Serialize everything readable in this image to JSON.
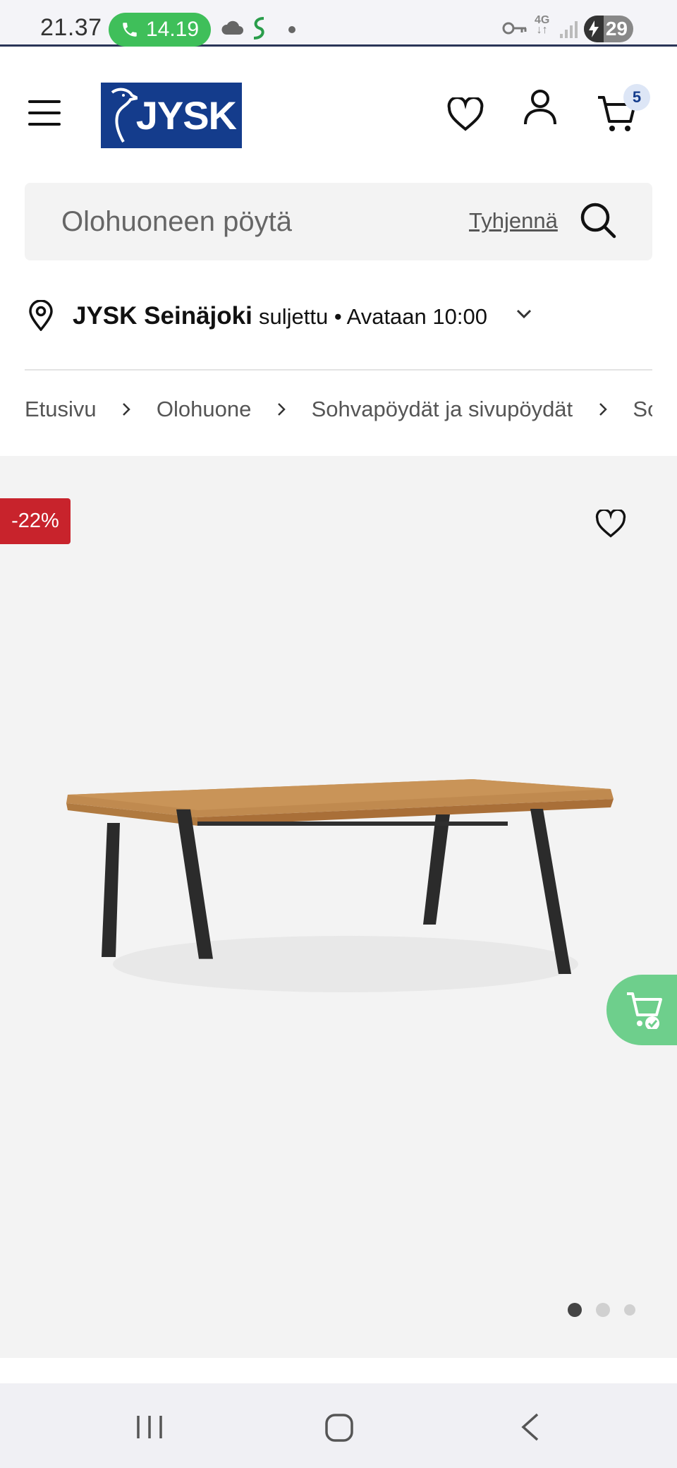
{
  "status_bar": {
    "time": "21.37",
    "call_timer": "14.19",
    "network": "4G",
    "battery": "29"
  },
  "header": {
    "logo_text": "JYSK",
    "cart_count": "5"
  },
  "search": {
    "value": "Olohuoneen pöytä",
    "clear_label": "Tyhjennä"
  },
  "store": {
    "name": "JYSK Seinäjoki",
    "status": "suljettu • Avataan 10:00"
  },
  "breadcrumb": [
    "Etusivu",
    "Olohuone",
    "Sohvapöydät ja sivupöydät",
    "Sohvapöydät"
  ],
  "product": {
    "discount_badge": "-22%",
    "image_count": 3,
    "active_image": 1
  },
  "colors": {
    "brand_blue": "#143c8c",
    "discount_red": "#c8232c",
    "call_green": "#3fbf5a",
    "cart_fab_green": "#6ecf8c",
    "gallery_bg": "#f3f3f3"
  },
  "icons": [
    "menu-icon",
    "heart-icon",
    "user-icon",
    "cart-icon",
    "search-icon",
    "location-pin-icon",
    "chevron-down-icon",
    "chevron-right-icon",
    "cart-check-icon"
  ]
}
